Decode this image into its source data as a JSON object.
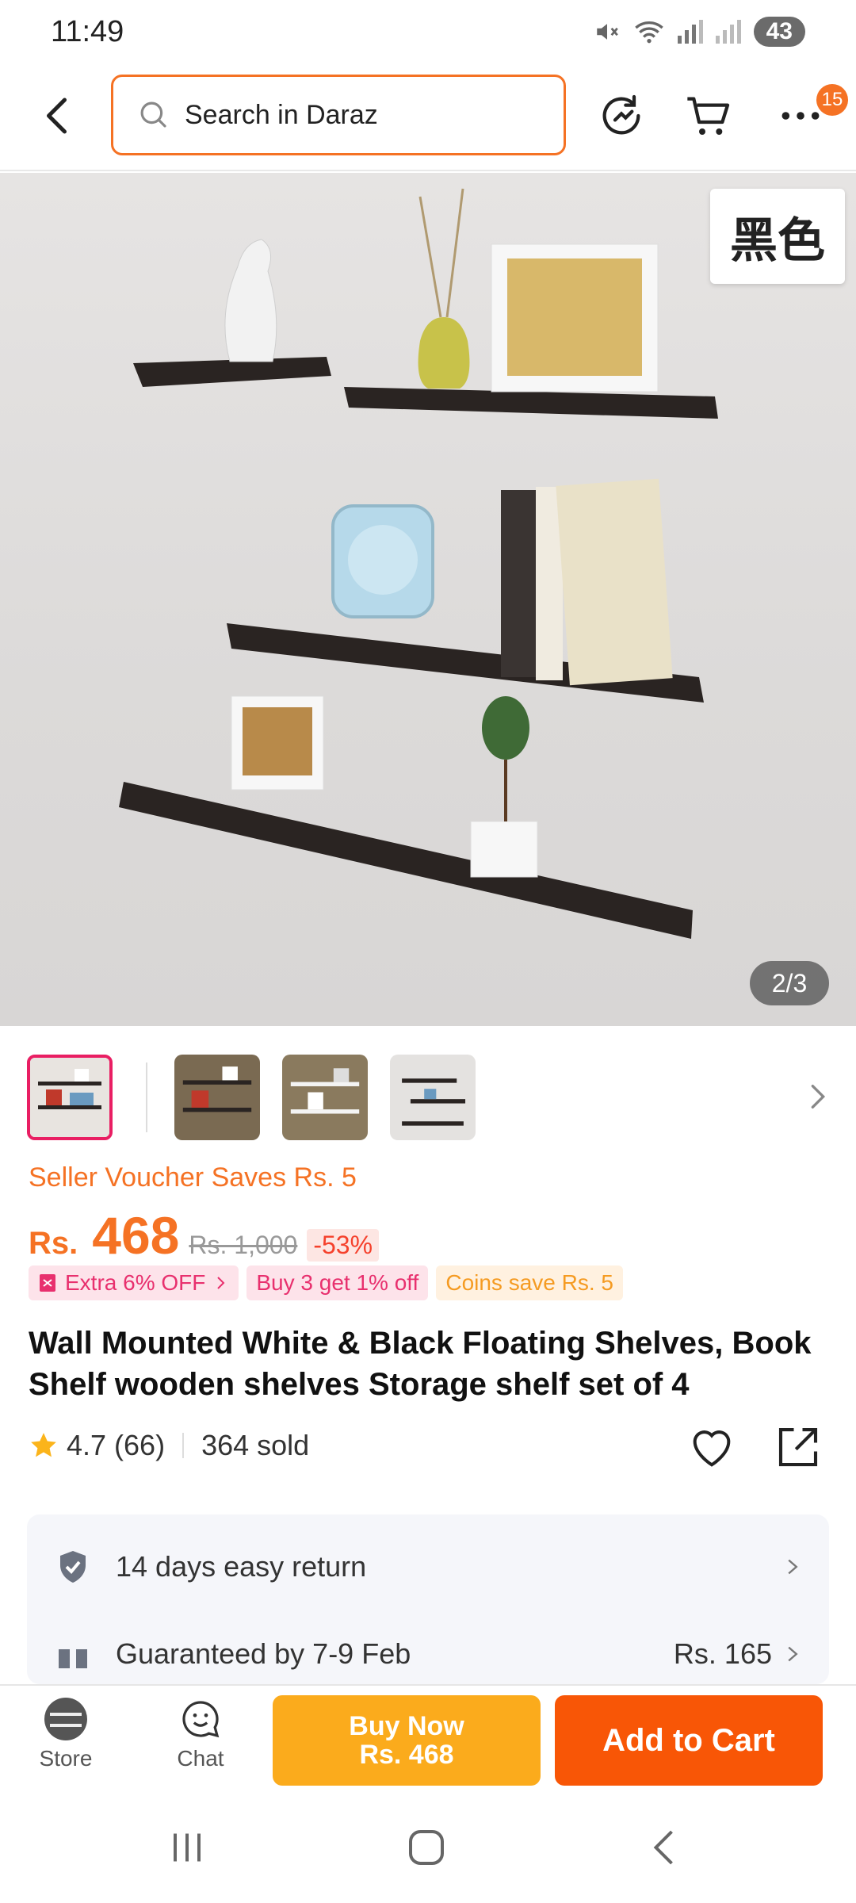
{
  "status_bar": {
    "time": "11:49",
    "battery": "43"
  },
  "header": {
    "search_placeholder": "Search in Daraz",
    "more_badge": "15"
  },
  "hero": {
    "corner_tag": "黑色",
    "image_counter": "2/3"
  },
  "price": {
    "voucher": "Seller Voucher Saves Rs. 5",
    "currency": "Rs.",
    "current": "468",
    "original": "Rs. 1,000",
    "discount": "-53%"
  },
  "promos": [
    {
      "label": "Extra 6% OFF"
    },
    {
      "label": "Buy 3 get 1% off"
    },
    {
      "label": "Coins save Rs. 5"
    }
  ],
  "product": {
    "title": "Wall Mounted White & Black Floating Shelves, Book Shelf wooden shelves Storage shelf set of 4",
    "rating": "4.7",
    "reviews": "(66)",
    "sold": "364 sold"
  },
  "services": [
    {
      "label": "14 days easy return",
      "price": ""
    },
    {
      "label": "Guaranteed by 7-9 Feb",
      "price": "Rs. 165"
    }
  ],
  "action_bar": {
    "store": "Store",
    "chat": "Chat",
    "buy_now": "Buy Now",
    "buy_now_price": "Rs. 468",
    "add_to_cart": "Add to Cart"
  },
  "colors": {
    "accent": "#f57224",
    "buy_now": "#fbab1c",
    "add_to_cart": "#f85606"
  }
}
